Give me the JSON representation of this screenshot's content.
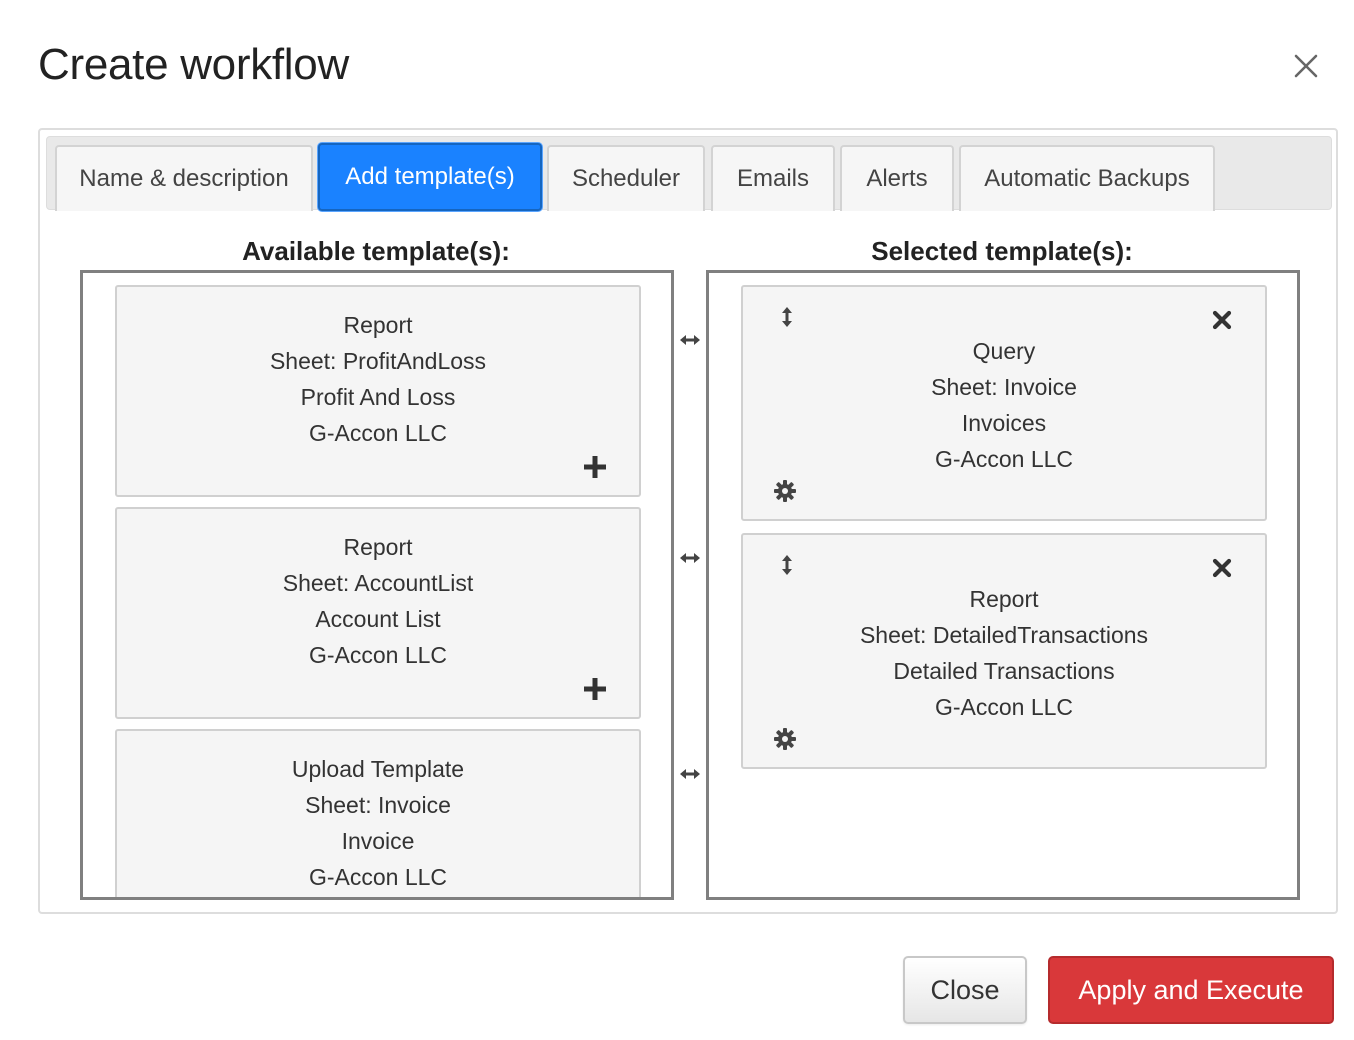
{
  "dialog": {
    "title": "Create workflow",
    "close_icon": "close-icon"
  },
  "tabs": [
    {
      "label": "Name & description",
      "active": false
    },
    {
      "label": "Add template(s)",
      "active": true
    },
    {
      "label": "Scheduler",
      "active": false
    },
    {
      "label": "Emails",
      "active": false
    },
    {
      "label": "Alerts",
      "active": false
    },
    {
      "label": "Automatic Backups",
      "active": false
    }
  ],
  "available": {
    "heading": "Available template(s):",
    "items": [
      {
        "lines": [
          "Report",
          "Sheet: ProfitAndLoss",
          "Profit And Loss",
          "G-Accon LLC"
        ],
        "action_icon": "plus-icon"
      },
      {
        "lines": [
          "Report",
          "Sheet: AccountList",
          "Account List",
          "G-Accon LLC"
        ],
        "action_icon": "plus-icon"
      },
      {
        "lines": [
          "Upload Template",
          "Sheet: Invoice",
          "Invoice",
          "G-Accon LLC"
        ],
        "action_icon": "plus-icon"
      }
    ]
  },
  "transfer_icon": "horizontal-arrows-icon",
  "selected": {
    "heading": "Selected template(s):",
    "items": [
      {
        "lines": [
          "Query",
          "Sheet: Invoice",
          "Invoices",
          "G-Accon LLC"
        ],
        "icons": [
          "vertical-arrows-icon",
          "remove-icon",
          "gear-icon"
        ]
      },
      {
        "lines": [
          "Report",
          "Sheet: DetailedTransactions",
          "Detailed Transactions",
          "G-Accon LLC"
        ],
        "icons": [
          "vertical-arrows-icon",
          "remove-icon",
          "gear-icon"
        ]
      }
    ]
  },
  "footer": {
    "close_label": "Close",
    "apply_label": "Apply and Execute"
  },
  "colors": {
    "active_tab": "#1a82ff",
    "apply_button": "#d9383a",
    "card_bg": "#f5f5f5",
    "listbox_border": "#808080"
  }
}
